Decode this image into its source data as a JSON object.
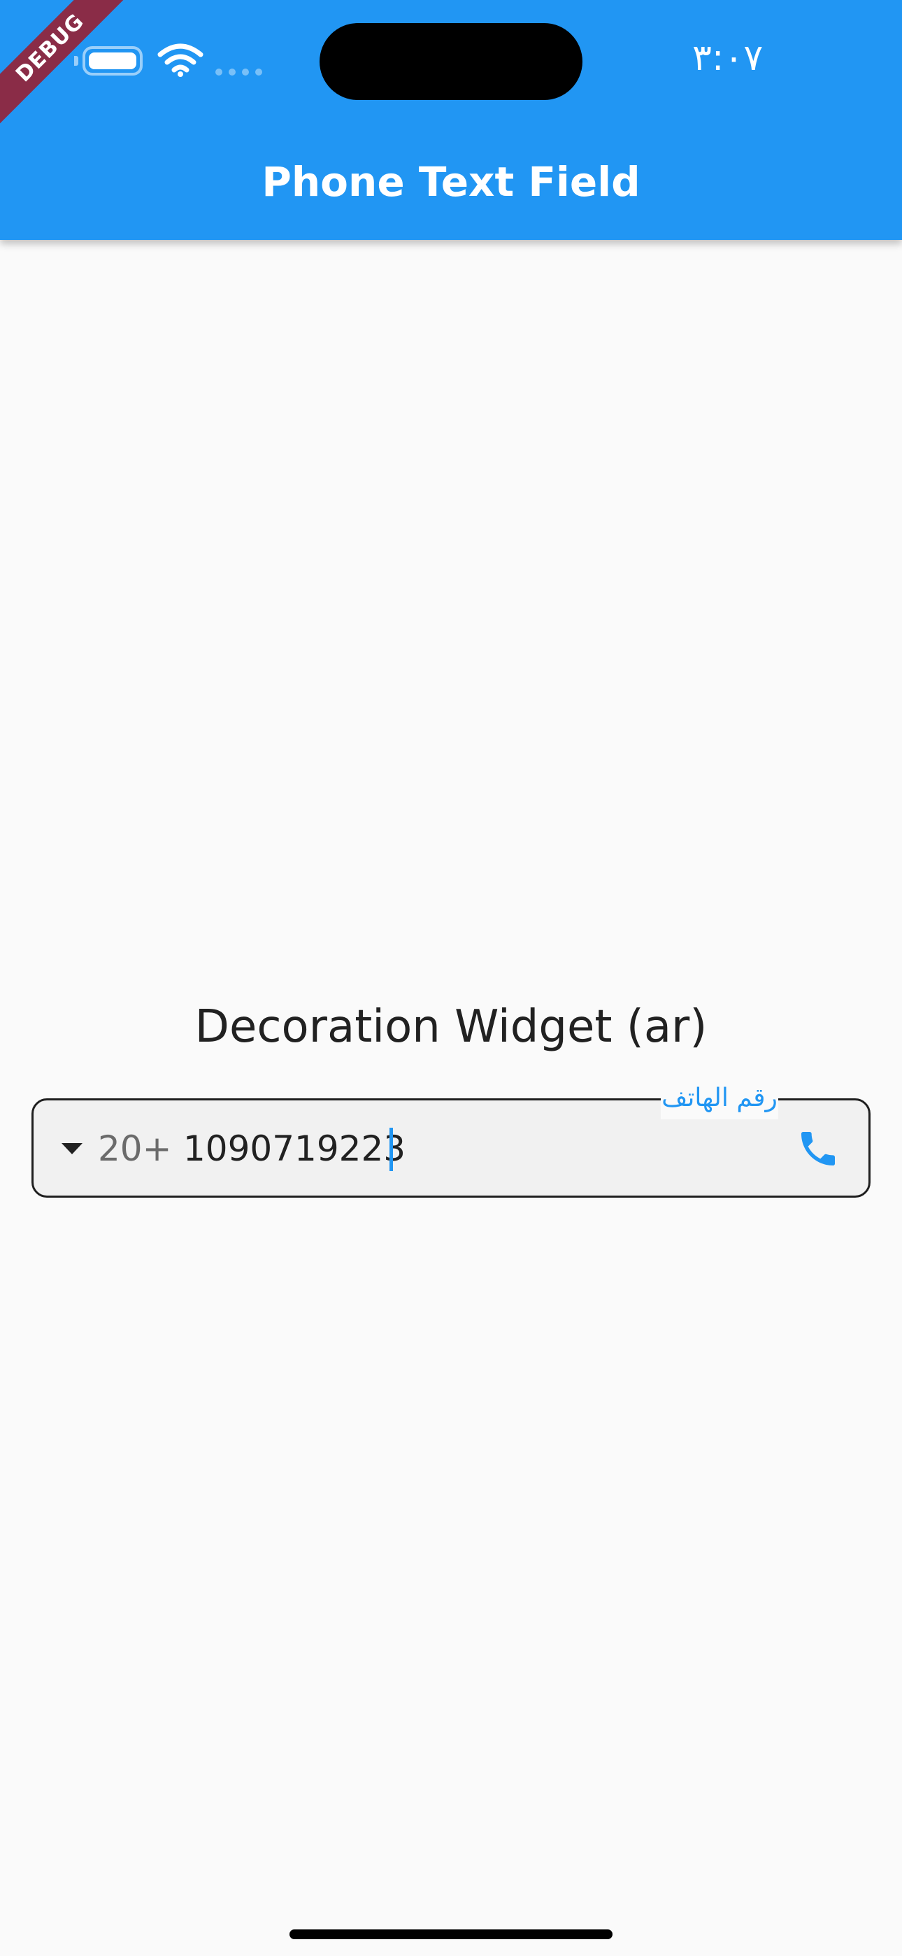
{
  "status_bar": {
    "time": "٣:٠٧",
    "battery_icon": "battery-icon",
    "wifi_icon": "wifi-icon",
    "signal_icon": "signal-dots-icon"
  },
  "debug_banner": {
    "label": "DEBUG",
    "color": "#8a2c47"
  },
  "app_bar": {
    "title": "Phone Text Field",
    "color": "#2196f3"
  },
  "main": {
    "section_title": "Decoration Widget (ar)",
    "phone_field": {
      "label": "رقم الهاتف",
      "country_code": "20+",
      "value": "1090719223",
      "prefix_icon": "dropdown-arrow-icon",
      "suffix_icon": "phone-icon",
      "accent_color": "#2196f3"
    }
  }
}
